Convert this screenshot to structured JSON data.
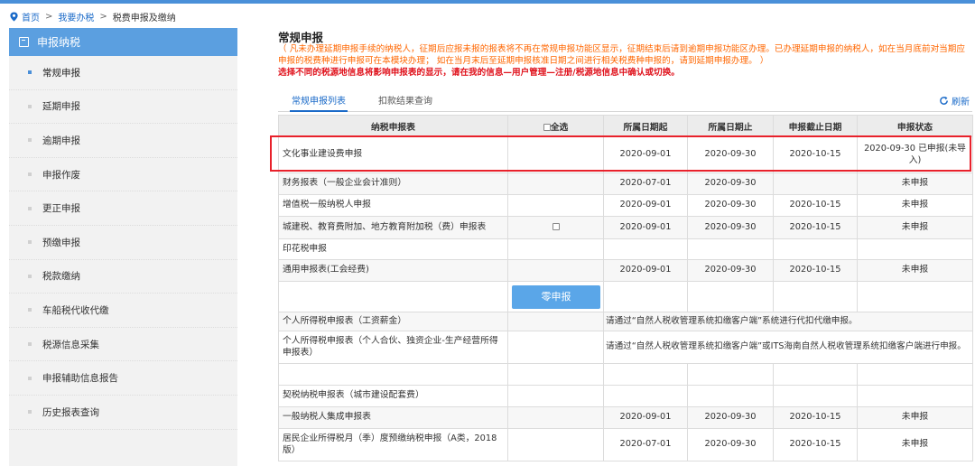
{
  "breadcrumb": {
    "home": "首页",
    "sep1": ">",
    "level2": "我要办税",
    "sep2": ">",
    "current": "税费申报及缴纳"
  },
  "sidebar": {
    "header": "申报纳税",
    "items": [
      {
        "label": "常规申报",
        "active": true
      },
      {
        "label": "延期申报"
      },
      {
        "label": "逾期申报"
      },
      {
        "label": "申报作废"
      },
      {
        "label": "更正申报"
      },
      {
        "label": "预缴申报"
      },
      {
        "label": "税款缴纳"
      },
      {
        "label": "车船税代收代缴"
      },
      {
        "label": "税源信息采集"
      },
      {
        "label": "申报辅助信息报告"
      },
      {
        "label": "历史报表查询"
      }
    ]
  },
  "main": {
    "title": "常规申报",
    "notice": "（ 凡未办理延期申报手续的纳税人，征期后应报未报的报表将不再在常规申报功能区显示，征期结束后请到逾期申报功能区办理。已办理延期申报的纳税人，如在当月底前对当期应申报的税费种进行申报可在本模块办理； 如在当月末后至延期申报核准日期之间进行相关税费种申报的，请到延期申报办理。 ）",
    "notice_red": "选择不同的税源地信息将影响申报表的显示，请在我的信息—用户管理—注册/税源地信息中确认或切换。"
  },
  "tabs": {
    "active": "常规申报列表",
    "other": "扣款结果查询",
    "refresh": "刷新"
  },
  "table": {
    "headers": {
      "name": "纳税申报表",
      "select_all": "全选",
      "start": "所属日期起",
      "end": "所属日期止",
      "deadline": "申报截止日期",
      "status": "申报状态"
    },
    "rows": [
      {
        "name": "文化事业建设费申报",
        "start": "2020-09-01",
        "end": "2020-09-30",
        "deadline": "2020-10-15",
        "status": "2020-09-30 已申报(未导入)"
      },
      {
        "name": "财务报表（一般企业会计准则）",
        "start": "2020-07-01",
        "end": "2020-09-30",
        "deadline": "",
        "status": "未申报"
      },
      {
        "name": "增值税一般纳税人申报",
        "start": "2020-09-01",
        "end": "2020-09-30",
        "deadline": "2020-10-15",
        "status": "未申报"
      },
      {
        "name": "城建税、教育费附加、地方教育附加税（费）申报表",
        "start": "2020-09-01",
        "end": "2020-09-30",
        "deadline": "2020-10-15",
        "status": "未申报"
      },
      {
        "name": "印花税申报",
        "start": "",
        "end": "",
        "deadline": "",
        "status": ""
      },
      {
        "name": "通用申报表(工会经费)",
        "start": "2020-09-01",
        "end": "2020-09-30",
        "deadline": "2020-10-15",
        "status": "未申报"
      },
      {
        "name": "个人所得税申报表（工资薪金）",
        "note": "请通过“自然人税收管理系统扣缴客户端”系统进行代扣代缴申报。"
      },
      {
        "name": "个人所得税申报表（个人合伙、独资企业-生产经营所得申报表）",
        "note": "请通过“自然人税收管理系统扣缴客户端”或ITS海南自然人税收管理系统扣缴客户端进行申报。"
      },
      {
        "name": "契税纳税申报表（城市建设配套费）",
        "start": "",
        "end": "",
        "deadline": "",
        "status": ""
      },
      {
        "name": "一般纳税人集成申报表",
        "start": "2020-09-01",
        "end": "2020-09-30",
        "deadline": "2020-10-15",
        "status": "未申报"
      },
      {
        "name": "居民企业所得税月（季）度预缴纳税申报（A类，2018版）",
        "start": "2020-07-01",
        "end": "2020-09-30",
        "deadline": "2020-10-15",
        "status": "未申报"
      }
    ],
    "zero_button": "零申报"
  },
  "colors": {
    "accent": "#1a6ac8",
    "sidebar_header": "#5b9fe0",
    "highlight": "#e8212b",
    "notice": "#ff6600",
    "notice_red": "#e0141e"
  }
}
